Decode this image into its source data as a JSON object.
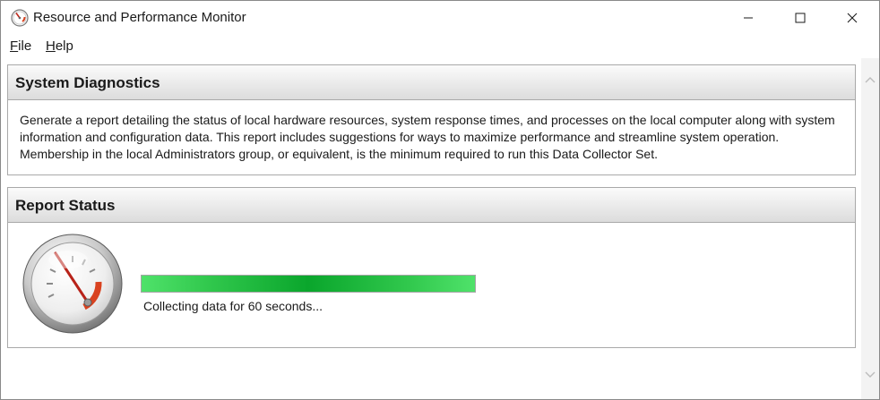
{
  "window": {
    "title": "Resource and Performance Monitor"
  },
  "menu": {
    "file": {
      "underlined": "F",
      "rest": "ile"
    },
    "help": {
      "underlined": "H",
      "rest": "elp"
    }
  },
  "system_diagnostics": {
    "title": "System Diagnostics",
    "description": "Generate a report detailing the status of local hardware resources, system response times, and processes on the local computer along with system information and configuration data. This report includes suggestions for ways to maximize performance and streamline system operation. Membership in the local Administrators group, or equivalent, is the minimum required to run this Data Collector Set."
  },
  "report_status": {
    "title": "Report Status",
    "progress": 1.0,
    "status_text": "Collecting data for 60 seconds..."
  },
  "icons": {
    "app": "performance-monitor-icon",
    "gauge": "speedometer-gauge-icon"
  },
  "colors": {
    "progress_green": "#0aa62c",
    "gauge_red": "#d9421f",
    "header_gray": "#dcdcdc"
  }
}
